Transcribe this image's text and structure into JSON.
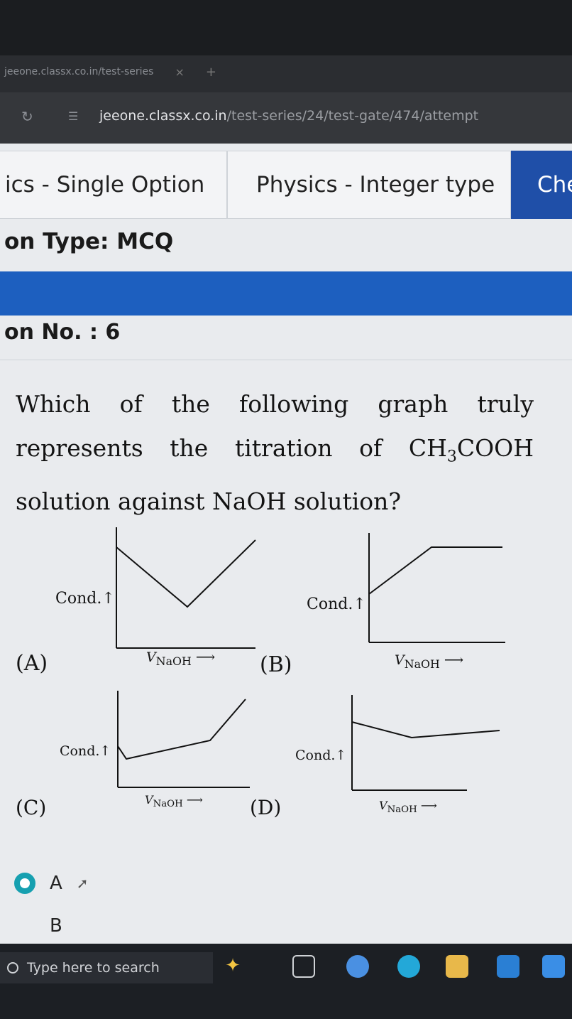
{
  "browser": {
    "tab_title": "jeeone.classx.co.in/test-series",
    "tab_close": "×",
    "new_tab": "+",
    "url_host": "jeeone.classx.co.in",
    "url_path": "/test-series/24/test-gate/474/attempt"
  },
  "subject_tabs": [
    {
      "label": "ics - Single Option"
    },
    {
      "label": "Physics - Integer type"
    },
    {
      "label": "Che"
    }
  ],
  "question_type": "on Type: MCQ",
  "question_no": "on No. : 6",
  "question": {
    "part1": "Which of the following graph truly represents the titration of CH",
    "sub": "3",
    "part2": "COOH solution against NaOH solution?"
  },
  "graphs": [
    {
      "letter": "(A)",
      "ylabel": "Cond.",
      "xlabel": "V",
      "xsub": "NaOH"
    },
    {
      "letter": "(B)",
      "ylabel": "Cond.",
      "xlabel": "V",
      "xsub": "NaOH"
    },
    {
      "letter": "(C)",
      "ylabel": "Cond.",
      "xlabel": "V",
      "xsub": "NaOH"
    },
    {
      "letter": "(D)",
      "ylabel": "Cond.",
      "xlabel": "V",
      "xsub": "NaOH"
    }
  ],
  "options": [
    {
      "label": "A",
      "selected": true
    },
    {
      "label": "B",
      "selected": false
    }
  ],
  "taskbar": {
    "search_placeholder": "Type here to search"
  },
  "colors": {
    "accent_blue": "#1d5fbf",
    "radio_selected": "#16a0b0"
  }
}
